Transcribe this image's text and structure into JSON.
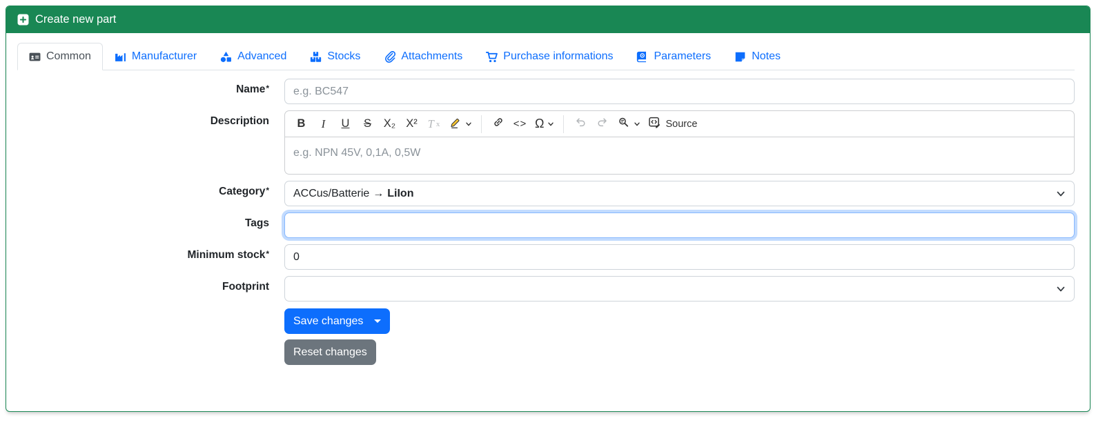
{
  "colors": {
    "header_green": "#198754",
    "link_blue": "#0d6efd",
    "save_blue": "#0d6efd",
    "reset_gray": "#6c757d",
    "highlight_yellow": "#fdc731",
    "focus_ring": "#86b7fe"
  },
  "header": {
    "title": "Create new part",
    "icon": "square-plus-icon"
  },
  "tabs": [
    {
      "label": "Common",
      "icon": "id-card-icon",
      "active": true
    },
    {
      "label": "Manufacturer",
      "icon": "factory-icon",
      "active": false
    },
    {
      "label": "Advanced",
      "icon": "shapes-icon",
      "active": false
    },
    {
      "label": "Stocks",
      "icon": "boxes-stacked-icon",
      "active": false
    },
    {
      "label": "Attachments",
      "icon": "paperclip-icon",
      "active": false
    },
    {
      "label": "Purchase informations",
      "icon": "shopping-cart-icon",
      "active": false
    },
    {
      "label": "Parameters",
      "icon": "book-icon",
      "active": false
    },
    {
      "label": "Notes",
      "icon": "sticky-note-icon",
      "active": false
    }
  ],
  "form": {
    "name": {
      "label": "Name",
      "required_marker": "*",
      "placeholder": "e.g. BC547",
      "value": ""
    },
    "description": {
      "label": "Description",
      "placeholder": "e.g. NPN 45V, 0,1A, 0,5W",
      "value": ""
    },
    "category": {
      "label": "Category",
      "required_marker": "*",
      "path_text": "ACCus/Batterie",
      "arrow": "→",
      "selected_text": "LiIon"
    },
    "tags": {
      "label": "Tags",
      "value": "",
      "focused": true
    },
    "minimum_stock": {
      "label": "Minimum stock",
      "required_marker": "*",
      "value": "0"
    },
    "footprint": {
      "label": "Footprint",
      "value": ""
    }
  },
  "editor_toolbar": {
    "bold": "B",
    "italic": "I",
    "underline": "U",
    "strikethrough": "S",
    "subscript": "X₂",
    "superscript": "X²",
    "remove_format_base": "T",
    "remove_format_sub": "x",
    "code": "<>",
    "special_characters": "Ω",
    "undo": "↶",
    "redo": "↷",
    "source_label": "Source"
  },
  "actions": {
    "save_label": "Save changes",
    "reset_label": "Reset changes"
  }
}
